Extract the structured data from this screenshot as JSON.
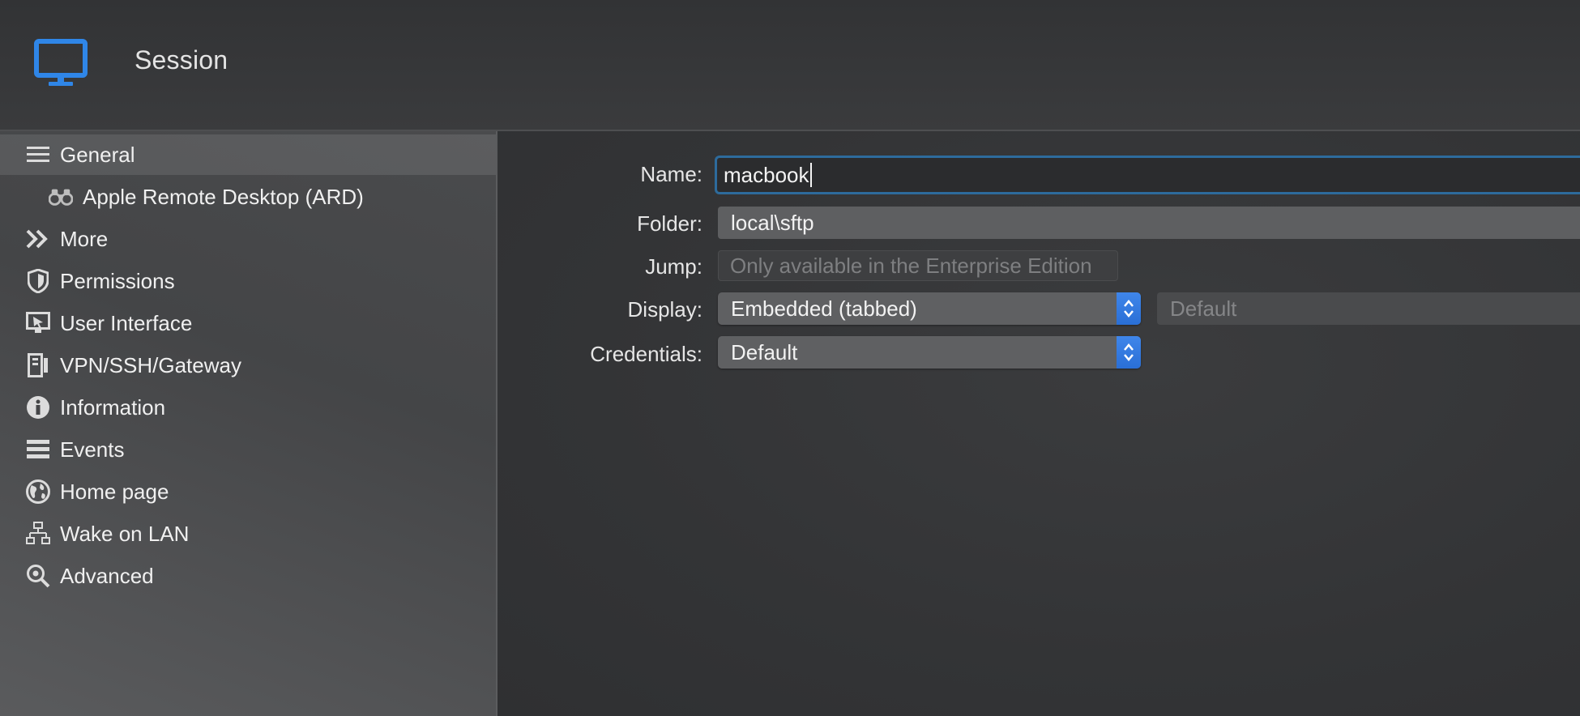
{
  "header": {
    "title": "Session",
    "icon": "monitor-icon",
    "accent": "#2f86e8"
  },
  "sidebar": {
    "items": [
      {
        "label": "General",
        "icon": "list-icon",
        "selected": true
      },
      {
        "label": "Apple Remote Desktop (ARD)",
        "icon": "binoculars-icon",
        "sub": true
      },
      {
        "label": "More",
        "icon": "double-chevron-icon"
      },
      {
        "label": "Permissions",
        "icon": "shield-icon"
      },
      {
        "label": "User Interface",
        "icon": "screen-pointer-icon"
      },
      {
        "label": "VPN/SSH/Gateway",
        "icon": "gateway-icon"
      },
      {
        "label": "Information",
        "icon": "info-icon"
      },
      {
        "label": "Events",
        "icon": "events-icon"
      },
      {
        "label": "Home page",
        "icon": "globe-icon"
      },
      {
        "label": "Wake on LAN",
        "icon": "network-icon"
      },
      {
        "label": "Advanced",
        "icon": "magnifier-gear-icon"
      }
    ]
  },
  "form": {
    "name_label": "Name:",
    "name_value": "macbook",
    "folder_label": "Folder:",
    "folder_value": "local\\sftp",
    "jump_label": "Jump:",
    "jump_placeholder": "Only available in the Enterprise Edition",
    "display_label": "Display:",
    "display_value": "Embedded (tabbed)",
    "display_secondary": "Default",
    "credentials_label": "Credentials:",
    "credentials_value": "Default"
  }
}
